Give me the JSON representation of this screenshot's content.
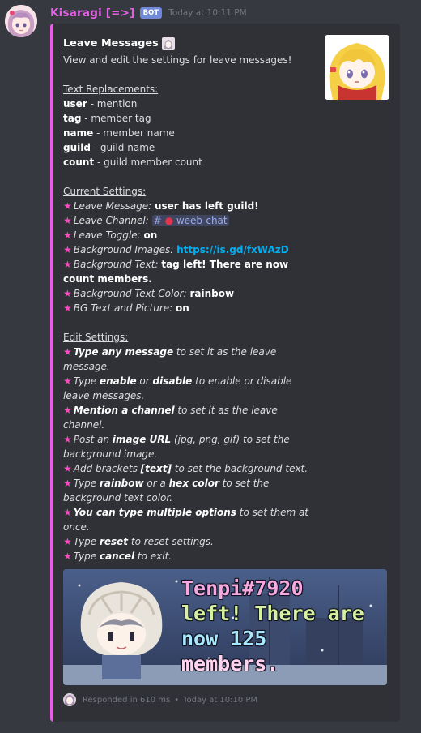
{
  "message": {
    "author": "Kisaragi [=>]",
    "bot_tag": "BOT",
    "timestamp": "Today at 10:11 PM"
  },
  "embed": {
    "accent_color": "#e65fe6",
    "title": "Leave Messages",
    "description": "View and edit the settings for leave messages!",
    "replacements_header": "Text Replacements:",
    "replacements": [
      {
        "key": "user",
        "desc": " - mention"
      },
      {
        "key": "tag",
        "desc": " - member tag"
      },
      {
        "key": "name",
        "desc": " - member name"
      },
      {
        "key": "guild",
        "desc": " - guild name"
      },
      {
        "key": "count",
        "desc": " - guild member count"
      }
    ],
    "current_header": "Current Settings:",
    "current": {
      "leave_message_label": "Leave Message:",
      "leave_message_value": "user has left guild!",
      "leave_channel_label": "Leave Channel:",
      "leave_channel_value": "weeb-chat",
      "leave_toggle_label": "Leave Toggle:",
      "leave_toggle_value": "on",
      "bg_images_label": "Background Images:",
      "bg_images_value": "https://is.gd/fxWAzD",
      "bg_text_label": "Background Text:",
      "bg_text_value": "tag left! There are now count members.",
      "bg_text_color_label": "Background Text Color:",
      "bg_text_color_value": "rainbow",
      "bg_text_picture_label": "BG Text and Picture:",
      "bg_text_picture_value": "on"
    },
    "edit_header": "Edit Settings:",
    "edit": {
      "e1_b": "Type any message",
      "e1_t": " to set it as the leave message.",
      "e2_a": "Type ",
      "e2_b1": "enable",
      "e2_m": " or ",
      "e2_b2": "disable",
      "e2_t": " to enable or disable leave messages.",
      "e3_b": "Mention a channel",
      "e3_t": " to set it as the leave channel.",
      "e4_a": "Post an ",
      "e4_b": "image URL",
      "e4_t": " (jpg, png, gif) to set the background image.",
      "e5_a": "Add brackets ",
      "e5_b": "[text]",
      "e5_t": " to set the background text.",
      "e6_a": "Type ",
      "e6_b1": "rainbow",
      "e6_m": " or a ",
      "e6_b2": "hex color",
      "e6_t": " to set the background text color.",
      "e7_b": "You can type multiple options",
      "e7_t": " to set them at once.",
      "e8_a": "Type ",
      "e8_b": "reset",
      "e8_t": " to reset settings.",
      "e9_a": "Type ",
      "e9_b": "cancel",
      "e9_t": " to exit."
    },
    "image_text": {
      "line1": "Tenpi#7920",
      "line2": "left! There are",
      "line3": "now 125",
      "line4": "members."
    },
    "footer": {
      "responded": "Responded in 610 ms",
      "separator": "•",
      "time": "Today at 10:10 PM"
    }
  }
}
